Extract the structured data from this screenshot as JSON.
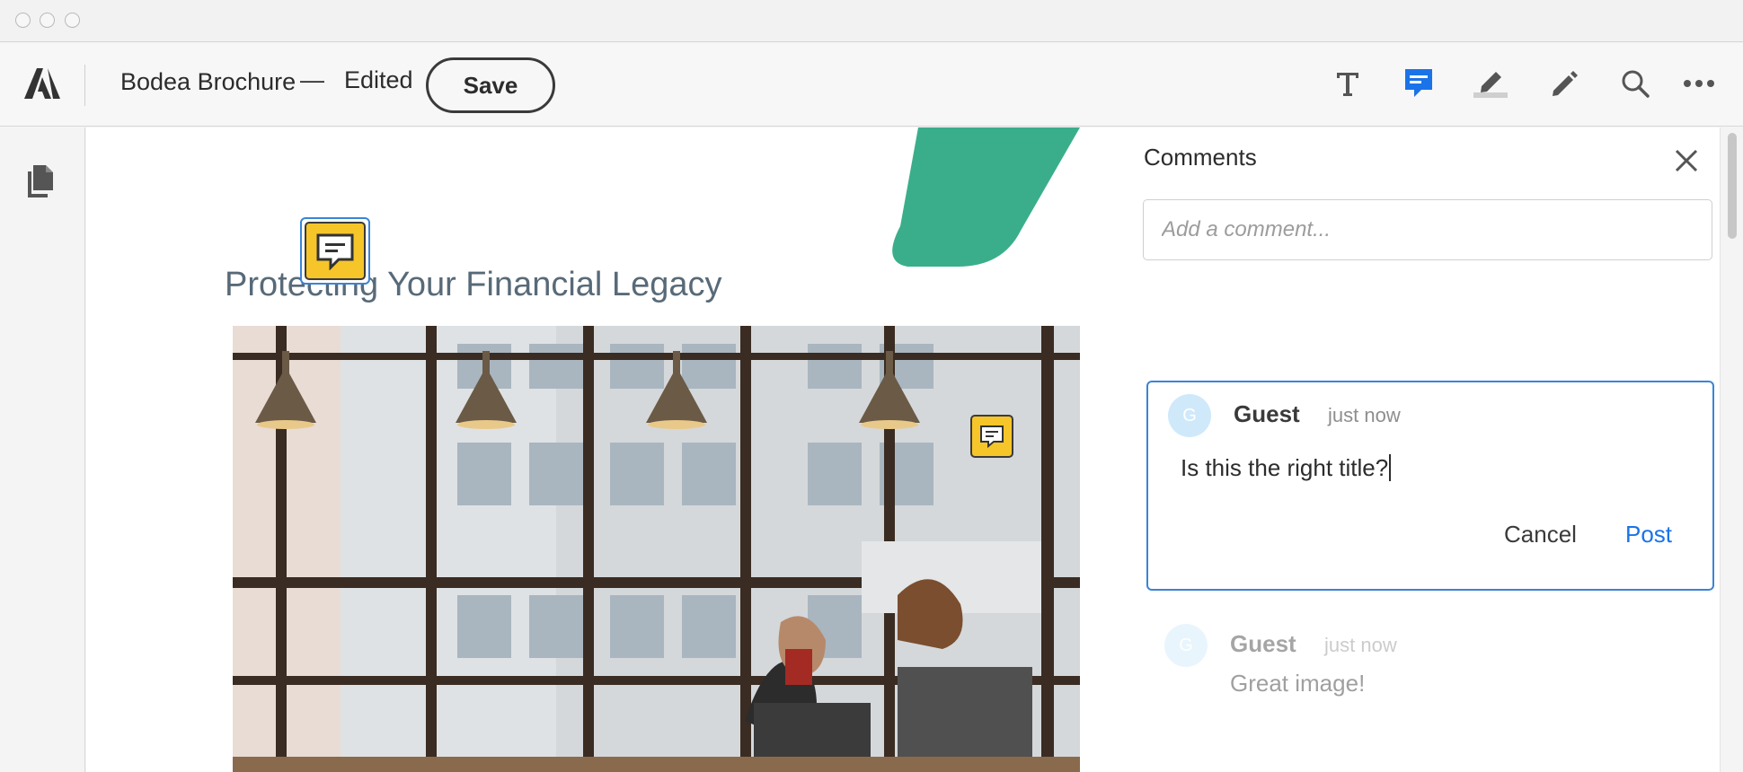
{
  "window": {
    "controls": [
      "close-dot",
      "minimize-dot",
      "zoom-dot"
    ]
  },
  "toolbar": {
    "app_icon": "adobe-logo-icon",
    "document_title": "Bodea Brochure",
    "separator": "—",
    "status": "Edited",
    "save_label": "Save",
    "tools": [
      "text-tool-icon",
      "comment-tool-icon",
      "highlight-tool-icon",
      "draw-tool-icon",
      "search-icon",
      "more-icon"
    ],
    "active_tool": "comment-tool-icon",
    "accent_color": "#1a73e8"
  },
  "left_rail": {
    "icon": "pages-icon"
  },
  "document": {
    "heading": "Protecting Your Financial Legacy",
    "accent_color": "#3aae8a",
    "note_color": "#f6c52a"
  },
  "comments_panel": {
    "title": "Comments",
    "close_icon": "close-icon",
    "input_placeholder": "Add a comment...",
    "active_comment": {
      "avatar_letter": "G",
      "author": "Guest",
      "time": "just now",
      "text": "Is this the right title?",
      "cancel_label": "Cancel",
      "post_label": "Post"
    },
    "comments": [
      {
        "avatar_letter": "G",
        "author": "Guest",
        "time": "just now",
        "text": "Great image!"
      }
    ]
  }
}
